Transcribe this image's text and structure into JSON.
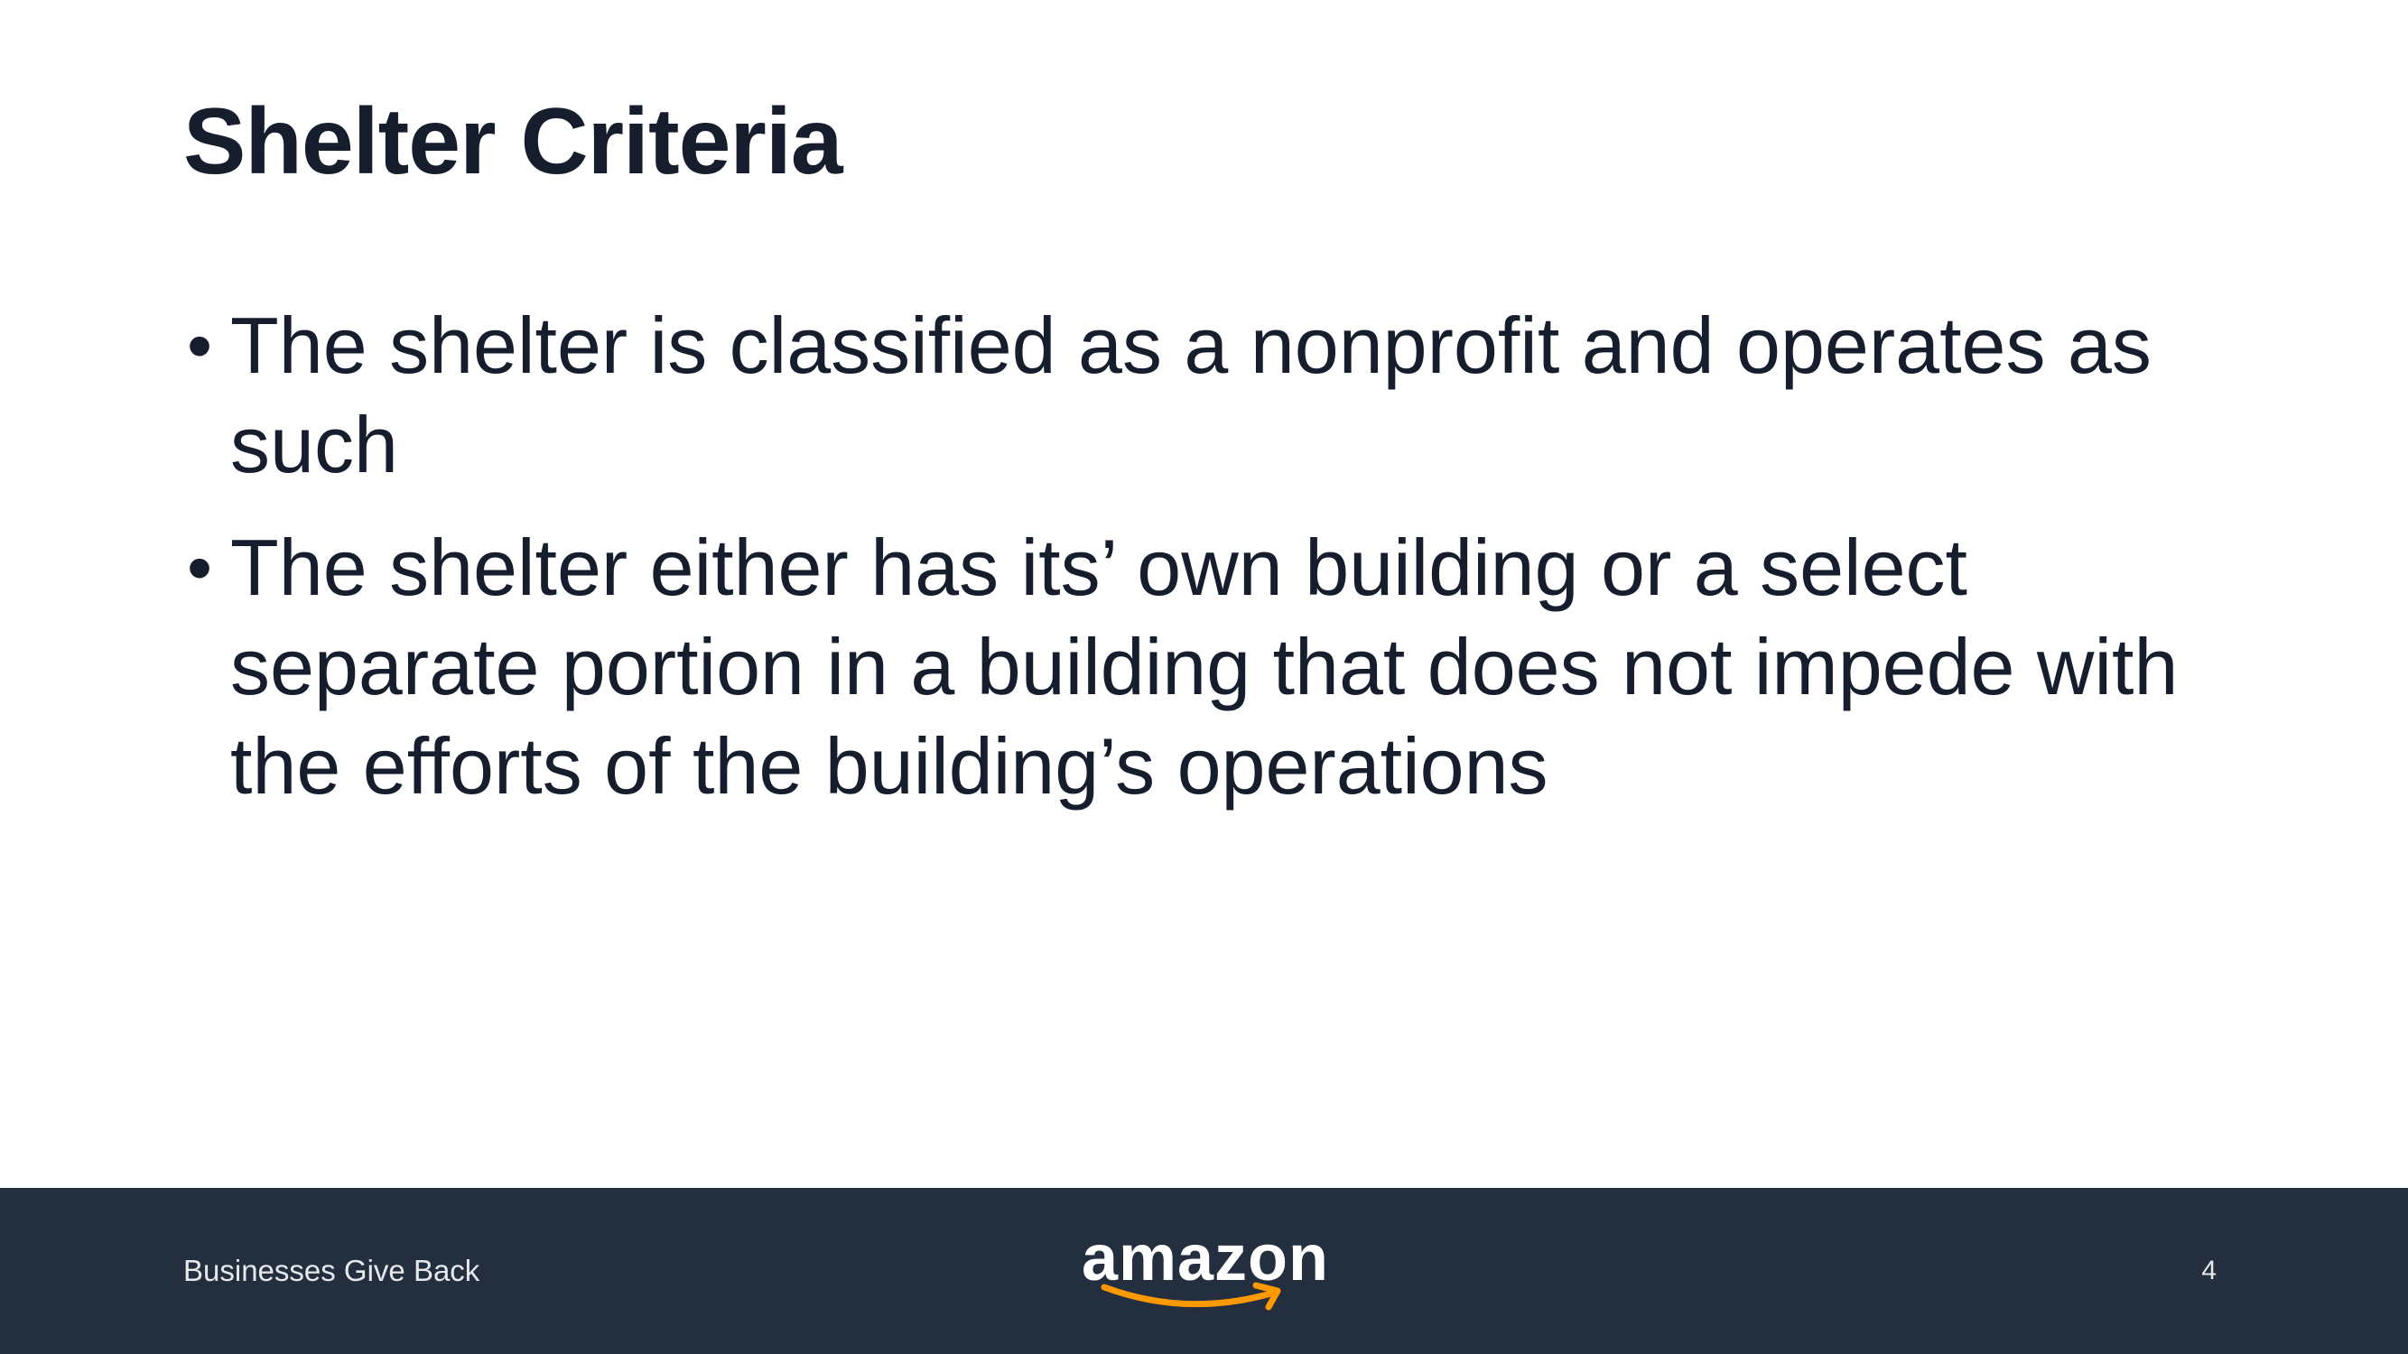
{
  "slide": {
    "title": "Shelter Criteria",
    "bullets": [
      "The shelter is classified as a nonprofit and operates as such",
      "The shelter either has its’ own building or a select separate portion in a building that does not impede with the efforts of the building’s operations"
    ],
    "bullet_marker": "•"
  },
  "footer": {
    "left_text": "Businesses Give Back",
    "logo_text": "amazon",
    "page_number": "4"
  },
  "colors": {
    "text": "#161e2d",
    "footer_bg": "#232f3e",
    "logo_smile": "#ff9900"
  }
}
